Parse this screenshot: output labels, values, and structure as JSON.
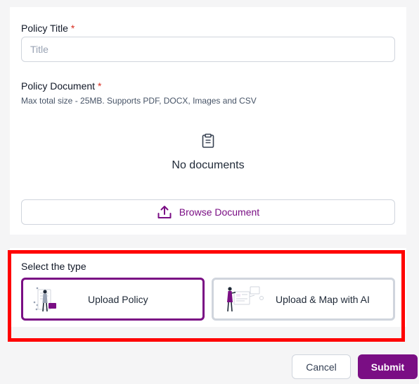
{
  "policy_title": {
    "label": "Policy Title",
    "required_mark": "*",
    "placeholder": "Title",
    "value": ""
  },
  "policy_document": {
    "label": "Policy Document",
    "required_mark": "*",
    "help": "Max total size - 25MB. Supports PDF, DOCX, Images and CSV",
    "empty_text": "No documents",
    "browse_label": "Browse Document"
  },
  "type_select": {
    "label": "Select the type",
    "options": [
      {
        "label": "Upload Policy",
        "selected": true
      },
      {
        "label": "Upload & Map with AI",
        "selected": false
      }
    ]
  },
  "footer": {
    "cancel_label": "Cancel",
    "submit_label": "Submit"
  },
  "colors": {
    "accent": "#7a0e84",
    "required": "#d92d20",
    "highlight": "#ff0000"
  }
}
